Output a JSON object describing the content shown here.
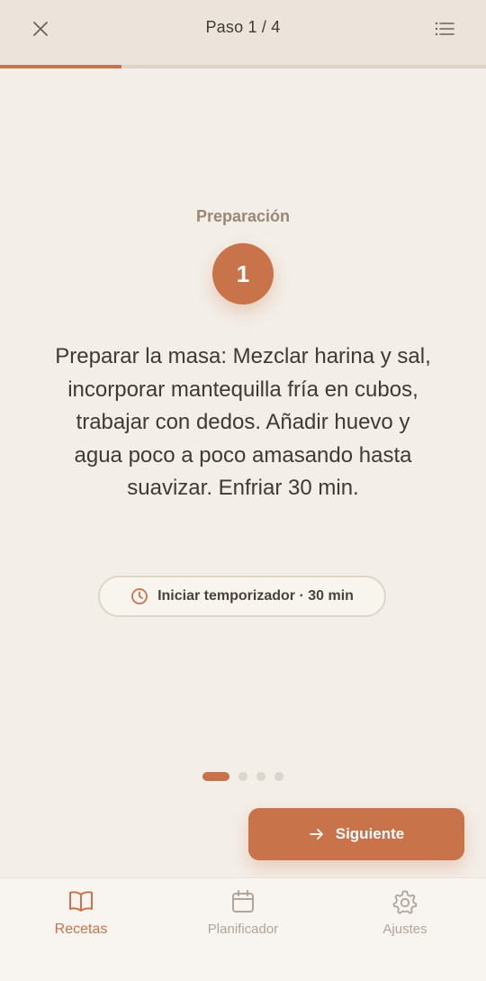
{
  "header": {
    "title": "Paso 1 / 4",
    "close_icon": "close-icon",
    "list_icon": "list-icon",
    "progress": 0.25
  },
  "step": {
    "section": "Preparación",
    "number": "1",
    "instruction": "Preparar la masa: Mezclar harina y sal, incorporar mantequilla fría en cubos, trabajar con dedos. Añadir huevo y agua poco a poco amasando hasta suavizar. Enfriar 30 min."
  },
  "timer": {
    "label": "Iniciar temporizador · 30 min",
    "icon": "clock-icon"
  },
  "pager": {
    "total": 4,
    "current": 1
  },
  "next_button": {
    "label": "Siguiente",
    "icon": "arrow-right-icon"
  },
  "nav": {
    "items": [
      {
        "label": "Recetas",
        "icon": "book-icon",
        "active": true
      },
      {
        "label": "Planificador",
        "icon": "calendar-icon",
        "active": false
      },
      {
        "label": "Ajustes",
        "icon": "gear-icon",
        "active": false
      }
    ]
  },
  "colors": {
    "accent": "#c8734a",
    "background": "#f3eee7",
    "header": "#ece4da"
  }
}
